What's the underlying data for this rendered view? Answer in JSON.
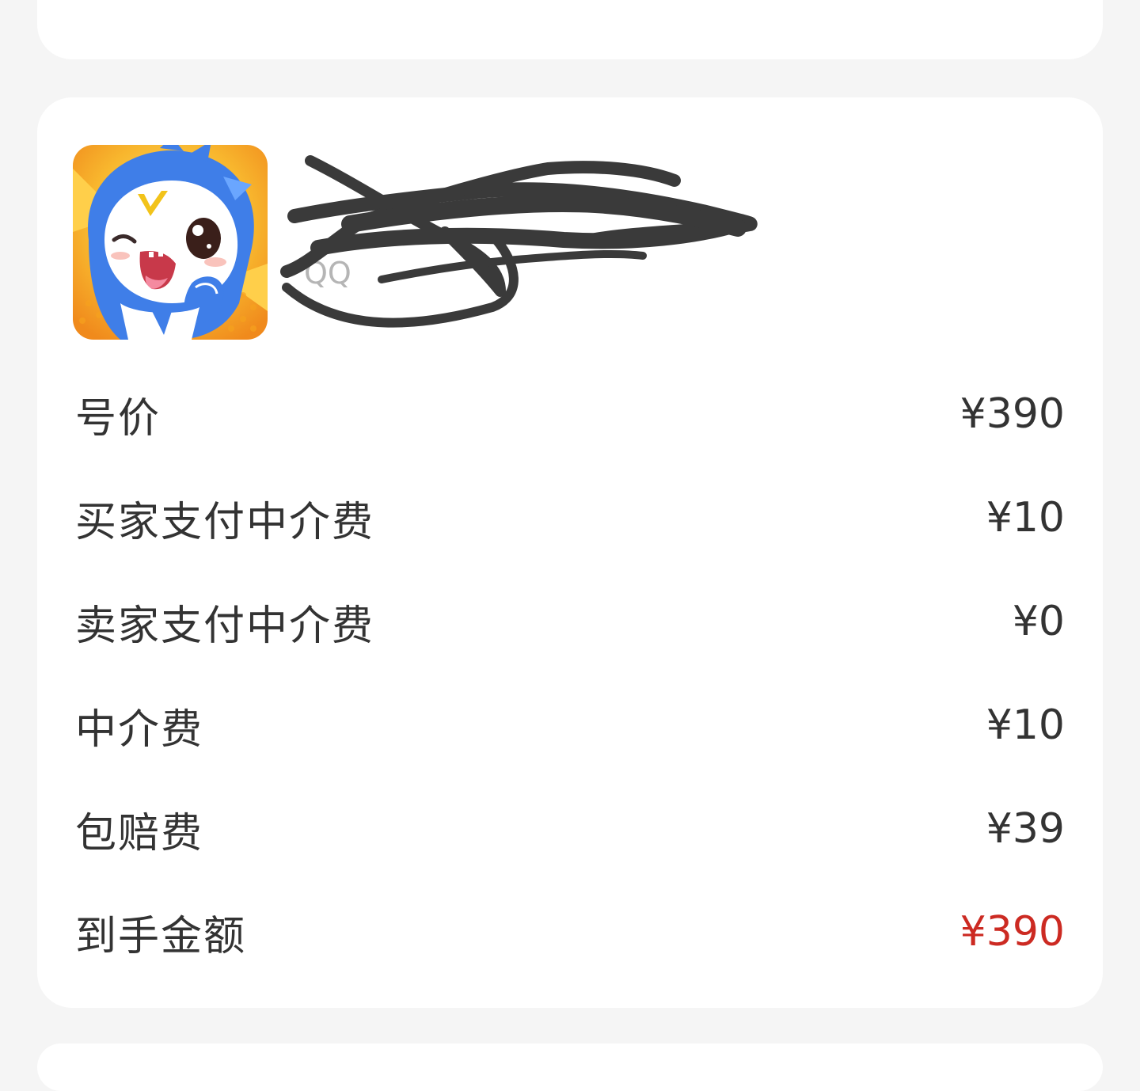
{
  "top_card": {
    "label": "",
    "value": ""
  },
  "game": {
    "icon": "qq-game-mascot-icon",
    "title": "",
    "subtitle": "QQ"
  },
  "fees": [
    {
      "label": "号价",
      "value": "¥390"
    },
    {
      "label": "买家支付中介费",
      "value": "¥10"
    },
    {
      "label": "卖家支付中介费",
      "value": "¥0"
    },
    {
      "label": "中介费",
      "value": "¥10"
    },
    {
      "label": "包赔费",
      "value": "¥39"
    },
    {
      "label": "到手金额",
      "value": "¥390"
    }
  ],
  "colors": {
    "page_bg": "#f5f5f5",
    "card_bg": "#ffffff",
    "text": "#333333",
    "subtext": "#b5b5b5",
    "highlight": "#cc2a22",
    "redaction": "#3a3a3a"
  }
}
